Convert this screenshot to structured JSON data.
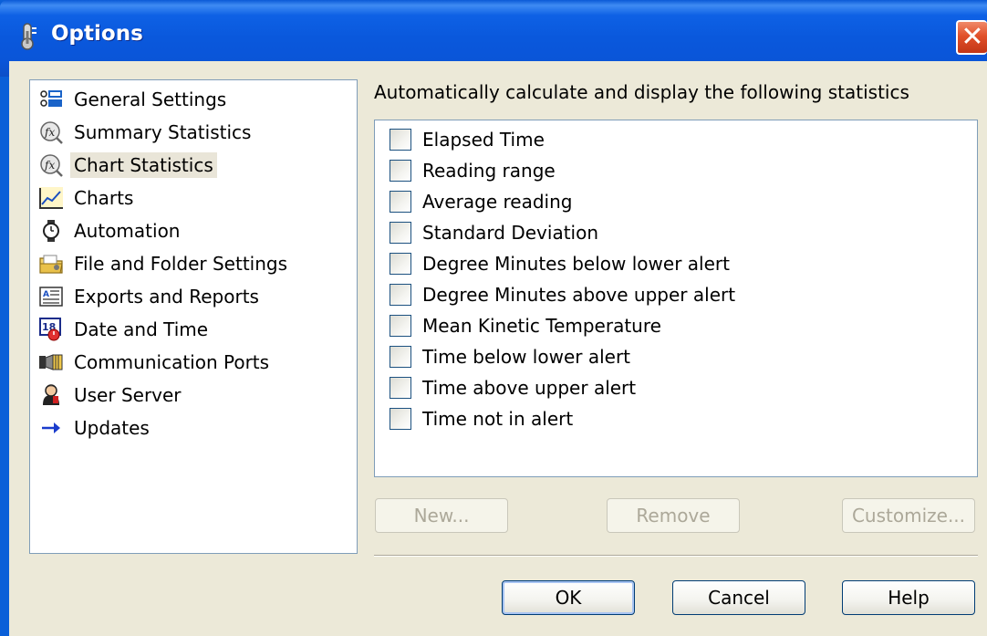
{
  "window": {
    "title": "Options",
    "title_icon": "thermometer-icon",
    "close_icon": "close-icon"
  },
  "nav": {
    "items": [
      {
        "label": "General Settings",
        "icon": "settings-list-icon"
      },
      {
        "label": "Summary Statistics",
        "icon": "fx-icon"
      },
      {
        "label": "Chart Statistics",
        "icon": "fx-icon",
        "selected": true
      },
      {
        "label": "Charts",
        "icon": "line-chart-icon"
      },
      {
        "label": "Automation",
        "icon": "watch-icon"
      },
      {
        "label": "File and Folder Settings",
        "icon": "folder-icon"
      },
      {
        "label": "Exports and Reports",
        "icon": "report-icon"
      },
      {
        "label": "Date and Time",
        "icon": "calendar-icon"
      },
      {
        "label": "Communication Ports",
        "icon": "port-icon"
      },
      {
        "label": "User Server",
        "icon": "user-icon"
      },
      {
        "label": "Updates",
        "icon": "arrow-right-icon"
      }
    ]
  },
  "main": {
    "heading": "Automatically calculate and display the following statistics",
    "stats": [
      {
        "label": "Elapsed Time",
        "checked": false
      },
      {
        "label": "Reading range",
        "checked": false
      },
      {
        "label": "Average reading",
        "checked": false
      },
      {
        "label": "Standard Deviation",
        "checked": false
      },
      {
        "label": "Degree Minutes below lower alert",
        "checked": false
      },
      {
        "label": "Degree Minutes above upper alert",
        "checked": false
      },
      {
        "label": "Mean Kinetic Temperature",
        "checked": false
      },
      {
        "label": "Time below lower alert",
        "checked": false
      },
      {
        "label": "Time above upper alert",
        "checked": false
      },
      {
        "label": "Time not in alert",
        "checked": false
      }
    ],
    "new_label": "New...",
    "remove_label": "Remove",
    "customize_label": "Customize..."
  },
  "footer": {
    "ok_label": "OK",
    "cancel_label": "Cancel",
    "help_label": "Help"
  },
  "colors": {
    "titlebar": "#0a5fd8",
    "dialog_bg": "#ece9d8",
    "close": "#e1502a",
    "selection": "#e9e5d8"
  }
}
